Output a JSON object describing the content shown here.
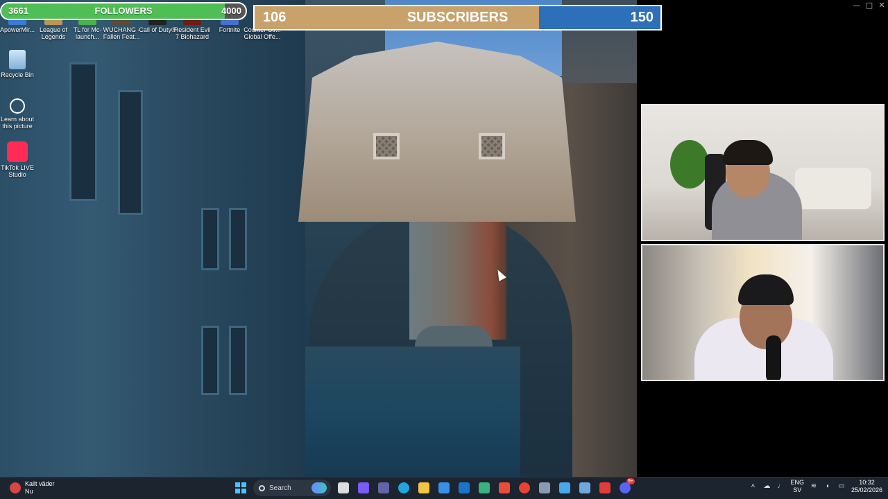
{
  "overlay": {
    "followers": {
      "current": "3661",
      "label": "FOLLOWERS",
      "goal": "4000",
      "progress": 0.915,
      "fill_color": "#4fbf55"
    },
    "subscribers": {
      "current": "106",
      "label": "SUBSCRIBERS",
      "goal": "150",
      "progress": 0.7,
      "fill_color": "#c8a26a",
      "bg_color": "#2d6fb8"
    }
  },
  "desktop": {
    "top_icons": [
      {
        "label": "ApowerMir...",
        "icon": "apowermirror-icon",
        "color": "#3a7bd5"
      },
      {
        "label": "League of Legends",
        "icon": "league-of-legends-icon",
        "color": "#b9975b"
      },
      {
        "label": "TL for Mc-launch...",
        "icon": "tlauncher-icon",
        "color": "#4caf50"
      },
      {
        "label": "WUCHANG - Fallen Feat...",
        "icon": "wuchang-icon",
        "color": "#5b4a3a"
      },
      {
        "label": "Call of Duty®",
        "icon": "call-of-duty-icon",
        "color": "#222222"
      },
      {
        "label": "Resident Evil 7 Biohazard",
        "icon": "resident-evil-icon",
        "color": "#6b1d1d"
      },
      {
        "label": "Fortnite",
        "icon": "fortnite-icon",
        "color": "#4a6fd0"
      },
      {
        "label": "Counter-Str... Global Offe...",
        "icon": "counter-strike-icon",
        "color": "#d8a23a"
      }
    ],
    "left_icons": [
      {
        "label": "Recycle Bin",
        "icon": "recycle-bin-icon",
        "color": "#9fc7e8"
      },
      {
        "label": "Learn about this picture",
        "icon": "learn-about-picture-icon",
        "color": "#ffffff"
      },
      {
        "label": "TikTok LIVE Studio",
        "icon": "tiktok-live-studio-icon",
        "color": "#fe2c55"
      }
    ]
  },
  "taskbar": {
    "weather_title": "Kallt väder",
    "weather_sub": "Nu",
    "search_placeholder": "Search",
    "apps": [
      {
        "icon": "windows-start-icon",
        "color": "#4cc2ff"
      },
      {
        "icon": "copilot-icon",
        "color": "#6b8afd"
      },
      {
        "icon": "task-view-icon",
        "color": "#dddddd"
      },
      {
        "icon": "copilot-app-icon",
        "color": "#7a5af8"
      },
      {
        "icon": "teams-icon",
        "color": "#6264a7"
      },
      {
        "icon": "edge-icon",
        "color": "#1fa5e0"
      },
      {
        "icon": "file-explorer-icon",
        "color": "#f3c344"
      },
      {
        "icon": "microsoft-store-icon",
        "color": "#3a8ee6"
      },
      {
        "icon": "outlook-icon",
        "color": "#1b74c9"
      },
      {
        "icon": "shield-vpn-icon",
        "color": "#36b37e"
      },
      {
        "icon": "m365-icon",
        "color": "#ea4c3b"
      },
      {
        "icon": "chrome-icon",
        "color": "#e94235"
      },
      {
        "icon": "box-app-icon",
        "color": "#8a9ab0"
      },
      {
        "icon": "photos-icon",
        "color": "#4aa8e8"
      },
      {
        "icon": "remote-desktop-icon",
        "color": "#6fa8dc"
      },
      {
        "icon": "obs-record-icon",
        "color": "#e03c3c"
      },
      {
        "icon": "discord-icon",
        "color": "#5865f2"
      }
    ],
    "discord_badge": "9+",
    "language": "ENG",
    "language_sub": "SV",
    "time": "10:32",
    "date": "25/02/2026"
  }
}
